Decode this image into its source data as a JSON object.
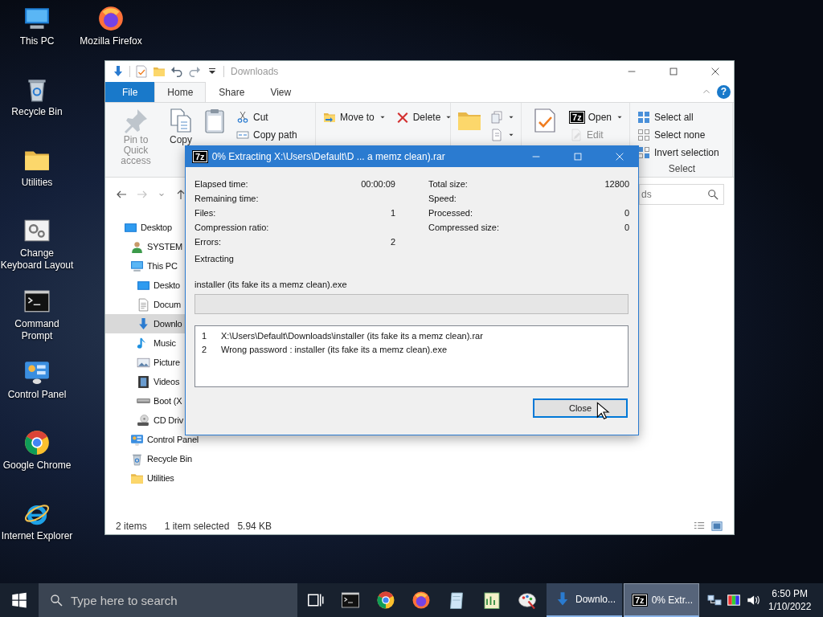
{
  "desktop_icons": [
    {
      "label": "This PC",
      "kind": "computer"
    },
    {
      "label": "Recycle Bin",
      "kind": "recycle"
    },
    {
      "label": "Utilities",
      "kind": "folder"
    },
    {
      "label": "Change Keyboard Layout",
      "kind": "settings"
    },
    {
      "label": "Command Prompt",
      "kind": "terminal"
    },
    {
      "label": "Control Panel",
      "kind": "panel"
    },
    {
      "label": "Google Chrome",
      "kind": "chrome"
    },
    {
      "label": "Internet Explorer",
      "kind": "ie"
    },
    {
      "label": "Mozilla Firefox",
      "kind": "firefox"
    }
  ],
  "explorer": {
    "title": "Downloads",
    "quick_access": [
      {
        "kind": "download"
      },
      {
        "kind": "properties"
      },
      {
        "kind": "folder"
      },
      {
        "kind": "undo"
      },
      {
        "kind": "redo"
      },
      {
        "kind": "customize"
      }
    ],
    "tabs": [
      {
        "label": "File",
        "kind": "file",
        "selected": false
      },
      {
        "label": "Home",
        "kind": "tab",
        "selected": true
      },
      {
        "label": "Share",
        "kind": "tab",
        "selected": false
      },
      {
        "label": "View",
        "kind": "tab",
        "selected": false
      }
    ],
    "help": "?",
    "ribbon": [
      {
        "large": [
          {
            "kind": "pin",
            "label": "Pin to Quick access",
            "disabled": true
          },
          {
            "kind": "copy",
            "label": "Copy",
            "disabled": false
          },
          {
            "kind": "paste",
            "disabled": false
          }
        ],
        "columns": [
          [
            {
              "kind": "cut",
              "label": "Cut",
              "disabled": false,
              "dropdown": false
            },
            {
              "kind": "copy-path",
              "label": "Copy path",
              "disabled": false,
              "dropdown": false
            }
          ]
        ]
      },
      {
        "columns": [
          [
            {
              "kind": "move",
              "label": "Move to",
              "disabled": false,
              "dropdown": true
            }
          ],
          [
            {
              "kind": "delete",
              "label": "Delete",
              "disabled": false,
              "dropdown": true
            }
          ]
        ]
      },
      {
        "large": [
          {
            "kind": "new-folder",
            "disabled": false
          }
        ],
        "columns": [
          [
            {
              "kind": "new-item",
              "disabled": false,
              "dropdown": true
            },
            {
              "kind": "easy-access",
              "disabled": false,
              "dropdown": true
            }
          ]
        ]
      },
      {
        "large": [
          {
            "kind": "properties",
            "disabled": false
          }
        ],
        "columns": [
          [
            {
              "kind": "open",
              "badge": "7z",
              "label": "Open",
              "disabled": false,
              "dropdown": true
            },
            {
              "kind": "edit",
              "label": "Edit",
              "disabled": true,
              "dropdown": false
            }
          ]
        ]
      },
      {
        "columns": [
          [
            {
              "kind": "select-all",
              "label": "Select all",
              "disabled": false,
              "dropdown": false
            },
            {
              "kind": "select-none",
              "label": "Select none",
              "disabled": false,
              "dropdown": false
            },
            {
              "kind": "invert",
              "label": "Invert selection",
              "disabled": false,
              "dropdown": false
            }
          ]
        ],
        "label": "Select"
      }
    ],
    "nav_buttons": [
      {
        "kind": "back",
        "disabled": false
      },
      {
        "kind": "forward",
        "disabled": true
      },
      {
        "kind": "recent",
        "disabled": false
      },
      {
        "kind": "up",
        "disabled": false
      }
    ],
    "search": {
      "placeholder": "ds"
    },
    "tree": [
      {
        "label": "Desktop",
        "kind": "desktop",
        "selected": false,
        "children": [
          {
            "label": "SYSTEM",
            "kind": "user",
            "selected": false
          },
          {
            "label": "This PC",
            "kind": "computer",
            "selected": false,
            "children": [
              {
                "label": "Deskto",
                "kind": "desktop",
                "selected": false
              },
              {
                "label": "Docum",
                "kind": "document",
                "selected": false
              },
              {
                "label": "Downlo",
                "kind": "download",
                "selected": true
              },
              {
                "label": "Music",
                "kind": "music",
                "selected": false
              },
              {
                "label": "Picture",
                "kind": "picture",
                "selected": false
              },
              {
                "label": "Videos",
                "kind": "video",
                "selected": false
              },
              {
                "label": "Boot (X",
                "kind": "drive",
                "selected": false
              },
              {
                "label": "CD Driv",
                "kind": "cd",
                "selected": false
              }
            ]
          },
          {
            "label": "Control Panel",
            "kind": "panel",
            "selected": false
          },
          {
            "label": "Recycle Bin",
            "kind": "recycle",
            "selected": false
          },
          {
            "label": "Utilities",
            "kind": "folder",
            "selected": false
          }
        ]
      }
    ],
    "status_bar": {
      "item_count": "2 items",
      "selection": "1 item selected",
      "size": "5.94 KB",
      "views": [
        {
          "kind": "details"
        },
        {
          "kind": "tiles"
        }
      ]
    }
  },
  "dialog": {
    "badge": "7z",
    "title": "0% Extracting X:\\Users\\Default\\D ...  a memz clean).rar",
    "stats_left": [
      {
        "label": "Elapsed time:",
        "value": "00:00:09"
      },
      {
        "label": "Remaining time:"
      },
      {
        "label": "Files:",
        "value": "1"
      },
      {
        "label": "Compression ratio:"
      },
      {
        "label": "Errors:",
        "value": "2"
      }
    ],
    "stats_right": [
      {
        "label": "Total size:",
        "value": "12800"
      },
      {
        "label": "Speed:"
      },
      {
        "label": "Processed:",
        "value": "0"
      },
      {
        "label": "Compressed size:",
        "value": "0"
      }
    ],
    "status": "Extracting",
    "current_file": "installer (its fake its a memz clean).exe",
    "progress": {
      "level": 0
    },
    "messages": [
      {
        "number": "1",
        "text": "X:\\Users\\Default\\Downloads\\installer (its fake its a memz clean).rar"
      },
      {
        "number": "2",
        "text": "Wrong password : installer (its fake its a memz clean).exe"
      }
    ],
    "button": {
      "label": "Close",
      "focused": true
    }
  },
  "taskbar": {
    "search_placeholder": "Type here to search",
    "pinned": [
      {
        "kind": "taskview"
      },
      {
        "kind": "terminal"
      },
      {
        "kind": "chrome"
      },
      {
        "kind": "firefox"
      },
      {
        "kind": "notepad"
      },
      {
        "kind": "chart"
      },
      {
        "kind": "paint"
      }
    ],
    "windows": [
      {
        "label": "Downlo...",
        "kind": "download",
        "selected": false
      },
      {
        "label": "0% Extr...",
        "kind": "archiver",
        "badge": "7z",
        "selected": true
      }
    ],
    "tray": [
      {
        "kind": "network"
      },
      {
        "kind": "color"
      },
      {
        "kind": "volume"
      }
    ],
    "time": "6:50 PM",
    "date": "1/10/2022"
  }
}
